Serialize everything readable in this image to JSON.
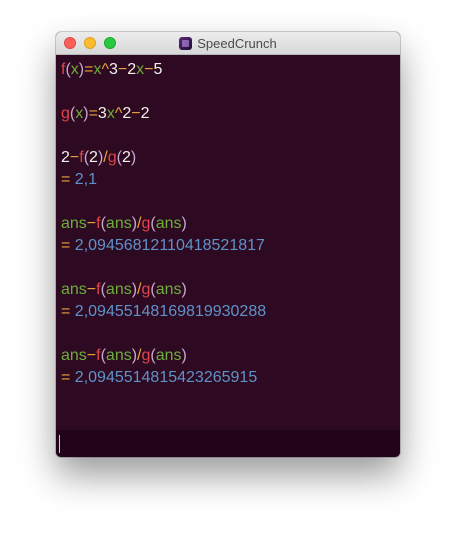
{
  "window": {
    "title": "SpeedCrunch"
  },
  "colors": {
    "background": "#2e0a22",
    "editor_background": "#21041a",
    "function": "#e0454b",
    "variable": "#6cae3a",
    "number": "#f4f1e8",
    "operator": "#e8a23a",
    "paren": "#c5a7cf",
    "result": "#5f92c9"
  },
  "history": [
    {
      "tokens": [
        {
          "t": "f",
          "k": "function"
        },
        {
          "t": "(",
          "k": "paren"
        },
        {
          "t": "x",
          "k": "variable"
        },
        {
          "t": ")",
          "k": "paren"
        },
        {
          "t": "=",
          "k": "operator"
        },
        {
          "t": "x",
          "k": "variable"
        },
        {
          "t": "^",
          "k": "operator"
        },
        {
          "t": "3",
          "k": "number"
        },
        {
          "t": "−",
          "k": "operator"
        },
        {
          "t": "2",
          "k": "number"
        },
        {
          "t": "x",
          "k": "variable"
        },
        {
          "t": "−",
          "k": "operator"
        },
        {
          "t": "5",
          "k": "number"
        }
      ],
      "result": null
    },
    {
      "tokens": [
        {
          "t": "g",
          "k": "function"
        },
        {
          "t": "(",
          "k": "paren"
        },
        {
          "t": "x",
          "k": "variable"
        },
        {
          "t": ")",
          "k": "paren"
        },
        {
          "t": "=",
          "k": "operator"
        },
        {
          "t": "3",
          "k": "number"
        },
        {
          "t": "x",
          "k": "variable"
        },
        {
          "t": "^",
          "k": "operator"
        },
        {
          "t": "2",
          "k": "number"
        },
        {
          "t": "−",
          "k": "operator"
        },
        {
          "t": "2",
          "k": "number"
        }
      ],
      "result": null
    },
    {
      "tokens": [
        {
          "t": "2",
          "k": "number"
        },
        {
          "t": "−",
          "k": "operator"
        },
        {
          "t": "f",
          "k": "function"
        },
        {
          "t": "(",
          "k": "paren"
        },
        {
          "t": "2",
          "k": "number"
        },
        {
          "t": ")",
          "k": "paren"
        },
        {
          "t": "/",
          "k": "operator"
        },
        {
          "t": "g",
          "k": "function"
        },
        {
          "t": "(",
          "k": "paren"
        },
        {
          "t": "2",
          "k": "number"
        },
        {
          "t": ")",
          "k": "paren"
        }
      ],
      "result": "2,1"
    },
    {
      "tokens": [
        {
          "t": "ans",
          "k": "variable"
        },
        {
          "t": "−",
          "k": "operator"
        },
        {
          "t": "f",
          "k": "function"
        },
        {
          "t": "(",
          "k": "paren"
        },
        {
          "t": "ans",
          "k": "variable"
        },
        {
          "t": ")",
          "k": "paren"
        },
        {
          "t": "/",
          "k": "operator"
        },
        {
          "t": "g",
          "k": "function"
        },
        {
          "t": "(",
          "k": "paren"
        },
        {
          "t": "ans",
          "k": "variable"
        },
        {
          "t": ")",
          "k": "paren"
        }
      ],
      "result": "2,09456812110418521817"
    },
    {
      "tokens": [
        {
          "t": "ans",
          "k": "variable"
        },
        {
          "t": "−",
          "k": "operator"
        },
        {
          "t": "f",
          "k": "function"
        },
        {
          "t": "(",
          "k": "paren"
        },
        {
          "t": "ans",
          "k": "variable"
        },
        {
          "t": ")",
          "k": "paren"
        },
        {
          "t": "/",
          "k": "operator"
        },
        {
          "t": "g",
          "k": "function"
        },
        {
          "t": "(",
          "k": "paren"
        },
        {
          "t": "ans",
          "k": "variable"
        },
        {
          "t": ")",
          "k": "paren"
        }
      ],
      "result": "2,09455148169819930288"
    },
    {
      "tokens": [
        {
          "t": "ans",
          "k": "variable"
        },
        {
          "t": "−",
          "k": "operator"
        },
        {
          "t": "f",
          "k": "function"
        },
        {
          "t": "(",
          "k": "paren"
        },
        {
          "t": "ans",
          "k": "variable"
        },
        {
          "t": ")",
          "k": "paren"
        },
        {
          "t": "/",
          "k": "operator"
        },
        {
          "t": "g",
          "k": "function"
        },
        {
          "t": "(",
          "k": "paren"
        },
        {
          "t": "ans",
          "k": "variable"
        },
        {
          "t": ")",
          "k": "paren"
        }
      ],
      "result": "2,0945514815423265915"
    }
  ],
  "result_prefix": "= ",
  "editor": {
    "value": ""
  }
}
